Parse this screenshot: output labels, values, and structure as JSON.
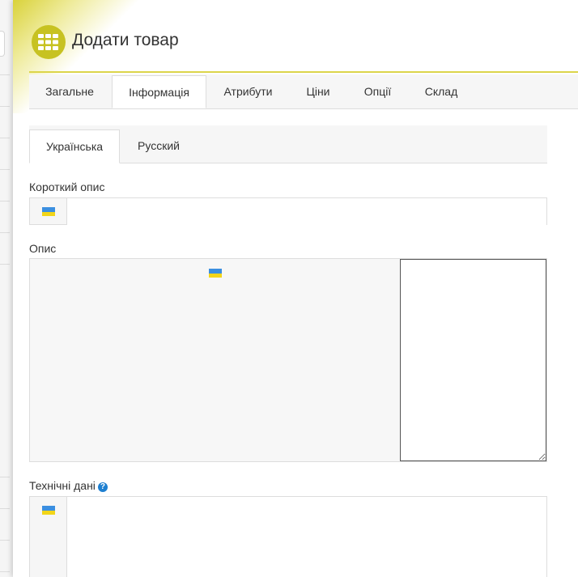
{
  "page": {
    "title": "Додати товар"
  },
  "colors": {
    "accent": "#c7c222",
    "flag_blue": "#3b8fe0",
    "flag_yellow": "#f2d519",
    "help_blue": "#1e7fd0"
  },
  "tabs_main": [
    {
      "label": "Загальне",
      "active": false
    },
    {
      "label": "Інформація",
      "active": true
    },
    {
      "label": "Атрибути",
      "active": false
    },
    {
      "label": "Ціни",
      "active": false
    },
    {
      "label": "Опції",
      "active": false
    },
    {
      "label": "Склад",
      "active": false
    }
  ],
  "tabs_lang": [
    {
      "label": "Українська",
      "active": true
    },
    {
      "label": "Русский",
      "active": false
    }
  ],
  "fields": {
    "short_description": {
      "label": "Короткий опис",
      "value": ""
    },
    "description": {
      "label": "Опис",
      "value": ""
    },
    "tech_data": {
      "label": "Технічні дані",
      "help_icon": "question-circle-icon"
    }
  }
}
